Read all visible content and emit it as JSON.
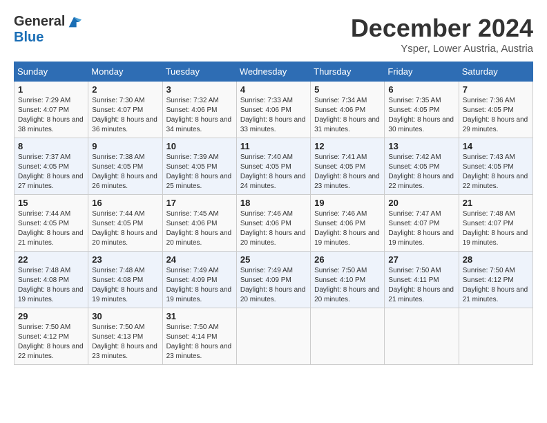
{
  "header": {
    "logo_general": "General",
    "logo_blue": "Blue",
    "month_title": "December 2024",
    "location": "Ysper, Lower Austria, Austria"
  },
  "days_of_week": [
    "Sunday",
    "Monday",
    "Tuesday",
    "Wednesday",
    "Thursday",
    "Friday",
    "Saturday"
  ],
  "weeks": [
    [
      {
        "day": "1",
        "sunrise": "7:29 AM",
        "sunset": "4:07 PM",
        "daylight": "8 hours and 38 minutes."
      },
      {
        "day": "2",
        "sunrise": "7:30 AM",
        "sunset": "4:07 PM",
        "daylight": "8 hours and 36 minutes."
      },
      {
        "day": "3",
        "sunrise": "7:32 AM",
        "sunset": "4:06 PM",
        "daylight": "8 hours and 34 minutes."
      },
      {
        "day": "4",
        "sunrise": "7:33 AM",
        "sunset": "4:06 PM",
        "daylight": "8 hours and 33 minutes."
      },
      {
        "day": "5",
        "sunrise": "7:34 AM",
        "sunset": "4:06 PM",
        "daylight": "8 hours and 31 minutes."
      },
      {
        "day": "6",
        "sunrise": "7:35 AM",
        "sunset": "4:05 PM",
        "daylight": "8 hours and 30 minutes."
      },
      {
        "day": "7",
        "sunrise": "7:36 AM",
        "sunset": "4:05 PM",
        "daylight": "8 hours and 29 minutes."
      }
    ],
    [
      {
        "day": "8",
        "sunrise": "7:37 AM",
        "sunset": "4:05 PM",
        "daylight": "8 hours and 27 minutes."
      },
      {
        "day": "9",
        "sunrise": "7:38 AM",
        "sunset": "4:05 PM",
        "daylight": "8 hours and 26 minutes."
      },
      {
        "day": "10",
        "sunrise": "7:39 AM",
        "sunset": "4:05 PM",
        "daylight": "8 hours and 25 minutes."
      },
      {
        "day": "11",
        "sunrise": "7:40 AM",
        "sunset": "4:05 PM",
        "daylight": "8 hours and 24 minutes."
      },
      {
        "day": "12",
        "sunrise": "7:41 AM",
        "sunset": "4:05 PM",
        "daylight": "8 hours and 23 minutes."
      },
      {
        "day": "13",
        "sunrise": "7:42 AM",
        "sunset": "4:05 PM",
        "daylight": "8 hours and 22 minutes."
      },
      {
        "day": "14",
        "sunrise": "7:43 AM",
        "sunset": "4:05 PM",
        "daylight": "8 hours and 22 minutes."
      }
    ],
    [
      {
        "day": "15",
        "sunrise": "7:44 AM",
        "sunset": "4:05 PM",
        "daylight": "8 hours and 21 minutes."
      },
      {
        "day": "16",
        "sunrise": "7:44 AM",
        "sunset": "4:05 PM",
        "daylight": "8 hours and 20 minutes."
      },
      {
        "day": "17",
        "sunrise": "7:45 AM",
        "sunset": "4:06 PM",
        "daylight": "8 hours and 20 minutes."
      },
      {
        "day": "18",
        "sunrise": "7:46 AM",
        "sunset": "4:06 PM",
        "daylight": "8 hours and 20 minutes."
      },
      {
        "day": "19",
        "sunrise": "7:46 AM",
        "sunset": "4:06 PM",
        "daylight": "8 hours and 19 minutes."
      },
      {
        "day": "20",
        "sunrise": "7:47 AM",
        "sunset": "4:07 PM",
        "daylight": "8 hours and 19 minutes."
      },
      {
        "day": "21",
        "sunrise": "7:48 AM",
        "sunset": "4:07 PM",
        "daylight": "8 hours and 19 minutes."
      }
    ],
    [
      {
        "day": "22",
        "sunrise": "7:48 AM",
        "sunset": "4:08 PM",
        "daylight": "8 hours and 19 minutes."
      },
      {
        "day": "23",
        "sunrise": "7:48 AM",
        "sunset": "4:08 PM",
        "daylight": "8 hours and 19 minutes."
      },
      {
        "day": "24",
        "sunrise": "7:49 AM",
        "sunset": "4:09 PM",
        "daylight": "8 hours and 19 minutes."
      },
      {
        "day": "25",
        "sunrise": "7:49 AM",
        "sunset": "4:09 PM",
        "daylight": "8 hours and 20 minutes."
      },
      {
        "day": "26",
        "sunrise": "7:50 AM",
        "sunset": "4:10 PM",
        "daylight": "8 hours and 20 minutes."
      },
      {
        "day": "27",
        "sunrise": "7:50 AM",
        "sunset": "4:11 PM",
        "daylight": "8 hours and 21 minutes."
      },
      {
        "day": "28",
        "sunrise": "7:50 AM",
        "sunset": "4:12 PM",
        "daylight": "8 hours and 21 minutes."
      }
    ],
    [
      {
        "day": "29",
        "sunrise": "7:50 AM",
        "sunset": "4:12 PM",
        "daylight": "8 hours and 22 minutes."
      },
      {
        "day": "30",
        "sunrise": "7:50 AM",
        "sunset": "4:13 PM",
        "daylight": "8 hours and 23 minutes."
      },
      {
        "day": "31",
        "sunrise": "7:50 AM",
        "sunset": "4:14 PM",
        "daylight": "8 hours and 23 minutes."
      },
      null,
      null,
      null,
      null
    ]
  ],
  "labels": {
    "sunrise": "Sunrise:",
    "sunset": "Sunset:",
    "daylight": "Daylight:"
  }
}
